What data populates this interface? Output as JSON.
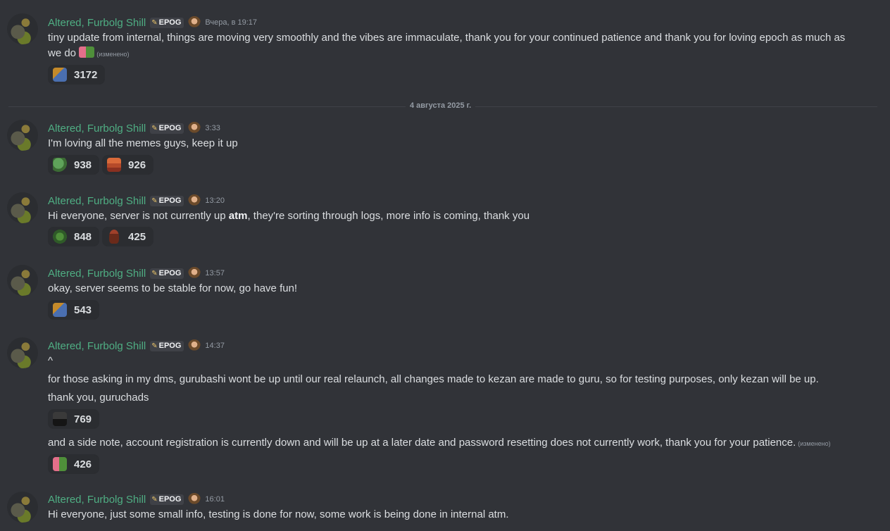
{
  "author": "Altered, Furbolg Shill",
  "tag": "EPOG",
  "edited": "(изменено)",
  "date_divider": "4 августа 2025 г.",
  "messages": [
    {
      "time": "Вчера, в 19:17",
      "text": "tiny update from internal, things are moving very smoothly and the vibes are immaculate, thank you for your continued patience and thank you for loving epoch as much as",
      "text_cont": "we do",
      "reactions": [
        {
          "emoji": "epoch-emoji",
          "count": "3172"
        }
      ]
    },
    {
      "time": "3:33",
      "text": "I'm loving all the memes guys, keep it up",
      "reactions": [
        {
          "emoji": "pepe-emoji",
          "count": "938"
        },
        {
          "emoji": "dwarf-emoji",
          "count": "926"
        }
      ]
    },
    {
      "time": "13:20",
      "text_before": "Hi everyone, server is not currently up ",
      "text_bold": "atm",
      "text_after": ", they're sorting through logs, more info is coming, thank you",
      "reactions": [
        {
          "emoji": "pepe-emoji",
          "count": "848"
        },
        {
          "emoji": "log-emoji",
          "count": "425"
        }
      ]
    },
    {
      "time": "13:57",
      "text": "okay, server seems to be stable for now, go have fun!",
      "reactions": [
        {
          "emoji": "epoch-emoji",
          "count": "543"
        }
      ]
    },
    {
      "time": "14:37",
      "line1": "^",
      "line2": "for those asking in my dms, gurubashi wont be up until our real relaunch, all changes made to kezan are made to guru, so for testing purposes, only kezan will be up.",
      "line3": "thank you, guruchads",
      "reactions": [
        {
          "emoji": "dark-emoji",
          "count": "769"
        }
      ],
      "followup": "and a side note, account registration is currently down and will be up at a later date and password resetting does not currently work, thank you for your patience.",
      "followup_reactions": [
        {
          "emoji": "pink-pepe-emoji",
          "count": "426"
        }
      ]
    },
    {
      "time": "16:01",
      "text": "Hi everyone, just some small info, testing is done for now, some work is being done in internal atm."
    }
  ]
}
